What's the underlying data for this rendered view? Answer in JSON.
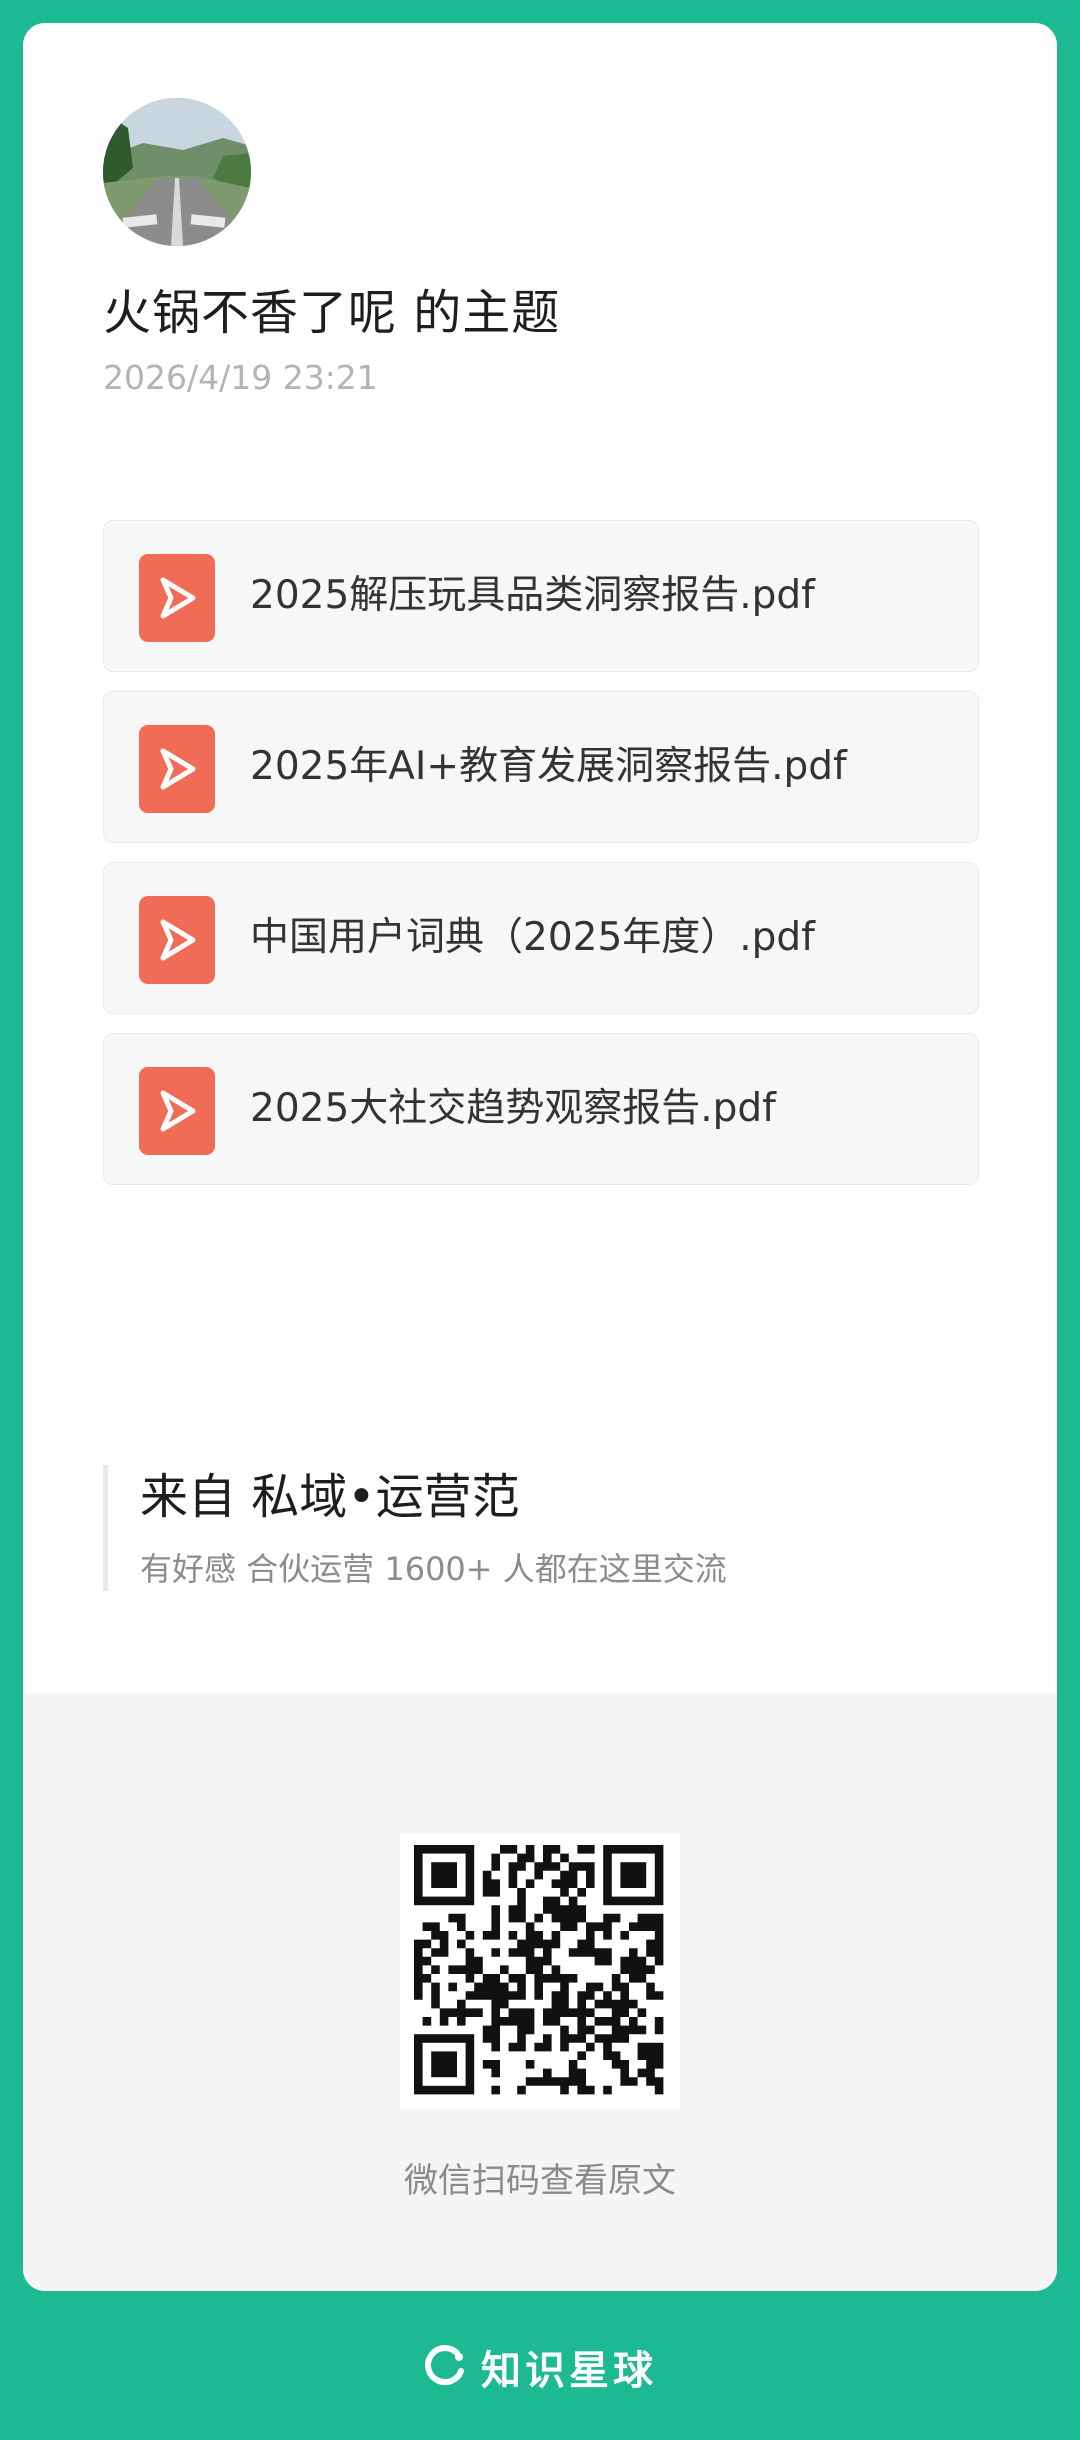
{
  "post": {
    "title": "火锅不香了呢 的主题",
    "timestamp": "2026/4/19 23:21",
    "avatar_alt": "road-photo-avatar"
  },
  "attachments": [
    {
      "name": "2025解压玩具品类洞察报告.pdf",
      "icon": "pdf-icon"
    },
    {
      "name": "2025年AI+教育发展洞察报告.pdf",
      "icon": "pdf-icon"
    },
    {
      "name": "中国用户词典（2025年度）.pdf",
      "icon": "pdf-icon"
    },
    {
      "name": "2025大社交趋势观察报告.pdf",
      "icon": "pdf-icon"
    }
  ],
  "source": {
    "title": "来自 私域•运营范",
    "description": "有好感 合伙运营 1600+ 人都在这里交流"
  },
  "qr": {
    "caption": "微信扫码查看原文"
  },
  "brand": {
    "name": "知识星球",
    "logo": "planet-logo-icon"
  },
  "colors": {
    "brand_green": "#1cb992",
    "pdf_red": "#f06c56"
  }
}
